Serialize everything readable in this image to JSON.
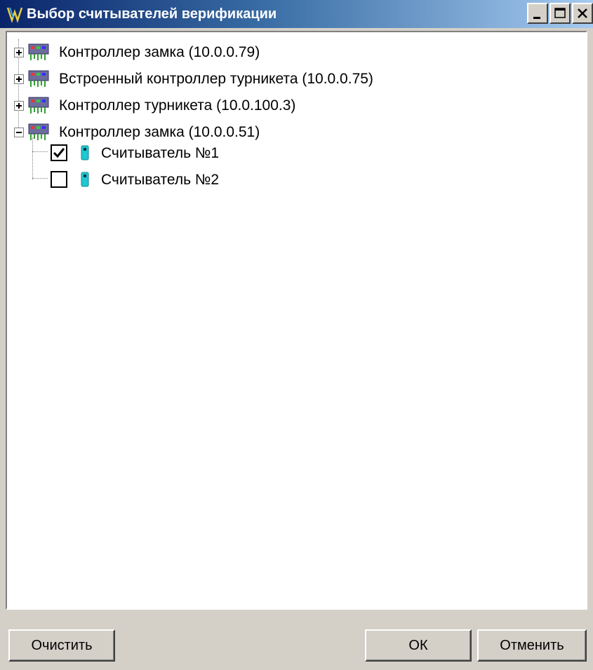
{
  "window": {
    "title": "Выбор считывателей верификации",
    "controls": [
      "minimize-icon",
      "maximize-icon",
      "close-icon"
    ]
  },
  "tree": {
    "nodes": [
      {
        "label": "Контроллер замка (10.0.0.79)",
        "expanded": false,
        "icon": "controller-icon"
      },
      {
        "label": "Встроенный контроллер турникета (10.0.0.75)",
        "expanded": false,
        "icon": "controller-icon"
      },
      {
        "label": "Контроллер турникета (10.0.100.3)",
        "expanded": false,
        "icon": "controller-icon"
      },
      {
        "label": "Контроллер замка (10.0.0.51)",
        "expanded": true,
        "icon": "controller-icon",
        "children": [
          {
            "label": "Считыватель №1",
            "checked": true,
            "icon": "reader-icon"
          },
          {
            "label": "Считыватель №2",
            "checked": false,
            "icon": "reader-icon"
          }
        ]
      }
    ]
  },
  "buttons": {
    "clear": "Очистить",
    "ok": "ОК",
    "cancel": "Отменить"
  },
  "colors": {
    "title_gradient_start": "#0a246a",
    "title_gradient_end": "#a6caf0",
    "face": "#d4d0c8",
    "reader": "#20c8d0"
  }
}
